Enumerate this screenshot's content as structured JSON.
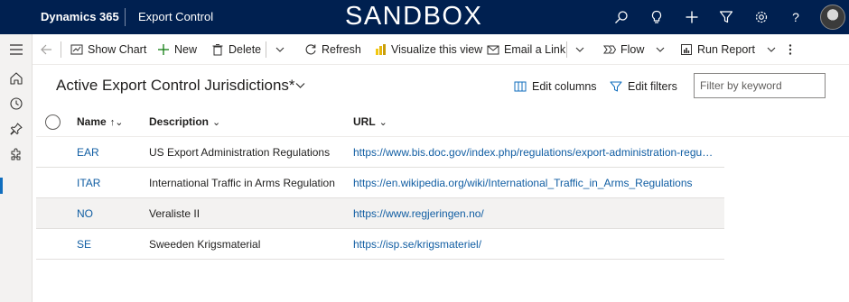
{
  "topbar": {
    "brand": "Dynamics 365",
    "app_name": "Export Control",
    "environment": "SANDBOX",
    "icons": [
      "search-icon",
      "lightbulb-icon",
      "plus-icon",
      "filter-icon",
      "gear-icon",
      "help-icon"
    ]
  },
  "rail": {
    "items": [
      "hamburger-icon",
      "home-icon",
      "recent-icon",
      "pin-icon",
      "puzzle-icon"
    ]
  },
  "commandbar": {
    "show_chart": "Show Chart",
    "new": "New",
    "delete": "Delete",
    "refresh": "Refresh",
    "visualize": "Visualize this view",
    "email_link": "Email a Link",
    "flow": "Flow",
    "run_report": "Run Report"
  },
  "view": {
    "title": "Active Export Control Jurisdictions*",
    "edit_columns": "Edit columns",
    "edit_filters": "Edit filters",
    "filter_placeholder": "Filter by keyword"
  },
  "grid": {
    "columns": {
      "name": "Name",
      "description": "Description",
      "url": "URL"
    },
    "rows": [
      {
        "name": "EAR",
        "description": "US Export Administration Regulations",
        "url": "https://www.bis.doc.gov/index.php/regulations/export-administration-regulati..."
      },
      {
        "name": "ITAR",
        "description": "International Traffic in Arms Regulation",
        "url": "https://en.wikipedia.org/wiki/International_Traffic_in_Arms_Regulations"
      },
      {
        "name": "NO",
        "description": "Veraliste II",
        "url": "https://www.regjeringen.no/"
      },
      {
        "name": "SE",
        "description": "Sweeden Krigsmaterial",
        "url": "https://isp.se/krigsmateriel/"
      }
    ]
  },
  "colors": {
    "topbar": "#002050",
    "link": "#115ea3",
    "accent": "#106ebe"
  }
}
